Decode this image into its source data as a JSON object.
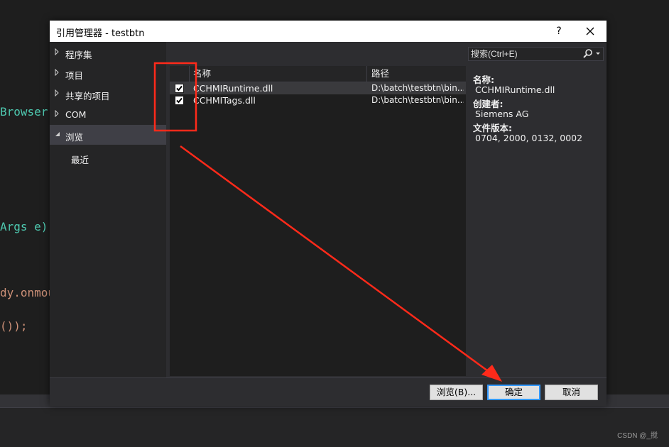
{
  "background_code": {
    "line1": "Browser,",
    "line2": "Args e)",
    "line3": "dy.onmou",
    "line4": "());"
  },
  "watermark": "CSDN @_搅",
  "dialog": {
    "title": "引用管理器 - testbtn",
    "help": "?",
    "nav": {
      "assemblies": "程序集",
      "projects": "项目",
      "shared_projects": "共享的项目",
      "com": "COM",
      "browse": "浏览",
      "recent": "最近"
    },
    "search": {
      "placeholder": "搜索(Ctrl+E)"
    },
    "list": {
      "columns": {
        "name": "名称",
        "path": "路径"
      },
      "rows": [
        {
          "checked": true,
          "name": "CCHMIRuntime.dll",
          "path": "D:\\batch\\testbtn\\bin..."
        },
        {
          "checked": true,
          "name": "CCHMITags.dll",
          "path": "D:\\batch\\testbtn\\bin..."
        }
      ]
    },
    "details": {
      "name_label": "名称:",
      "name_value": "CCHMIRuntime.dll",
      "creator_label": "创建者:",
      "creator_value": "Siemens AG",
      "version_label": "文件版本:",
      "version_value": "0704, 2000, 0132, 0002"
    },
    "buttons": {
      "browse": "浏览(B)...",
      "ok": "确定",
      "cancel": "取消"
    }
  },
  "colors": {
    "annotation_red": "#ff2a1a",
    "code_blue": "#9cdcfe",
    "code_teal": "#4ec9b0",
    "code_orange": "#ce9178",
    "accent": "#3399ff"
  }
}
